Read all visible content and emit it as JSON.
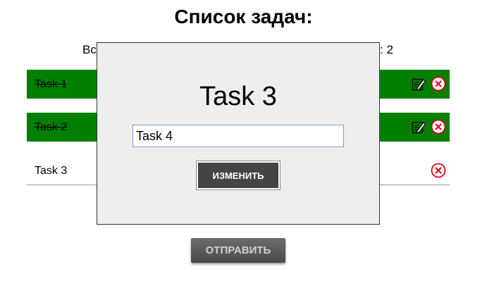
{
  "page": {
    "title": "Список задач:"
  },
  "summary": {
    "left_visible": "Вс",
    "right_visible": ": 2"
  },
  "tasks": [
    {
      "text": "Task 1",
      "completed": true
    },
    {
      "text": "Task 2",
      "completed": true
    },
    {
      "text": "Task 3",
      "completed": false
    }
  ],
  "modal": {
    "title": "Task 3",
    "input_value": "Task 4",
    "button_label": "ИЗМЕНИТЬ"
  },
  "submit": {
    "label": "ОТПРАВИТЬ"
  },
  "colors": {
    "done_row": "#008000",
    "delete_icon": "#e0001a",
    "modal_bg": "#eeeeee"
  },
  "icons": {
    "edit": "edit-note-icon",
    "delete": "close-circle-icon"
  }
}
